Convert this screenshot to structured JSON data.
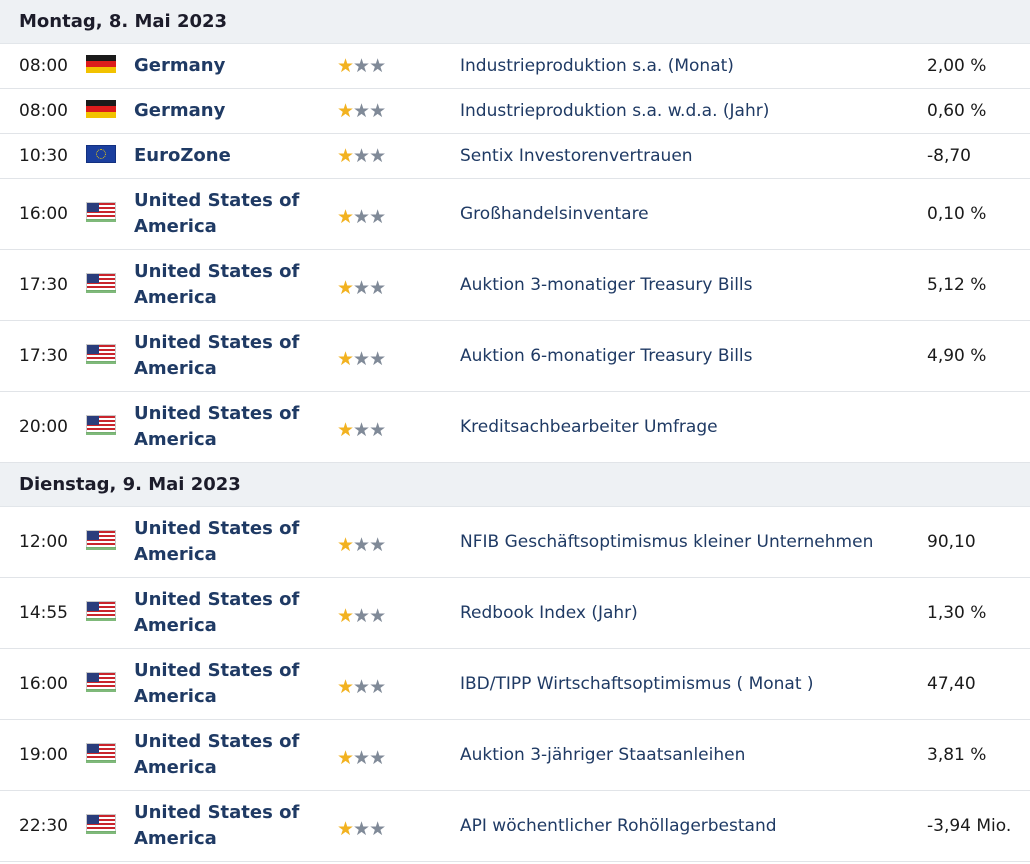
{
  "days": [
    {
      "date": "Montag, 8. Mai 2023",
      "rows": [
        {
          "time": "08:00",
          "flag": "de",
          "country": "Germany",
          "rating": 1,
          "event": "Industrieproduktion s.a. (Monat)",
          "value": "2,00 %",
          "tall": false
        },
        {
          "time": "08:00",
          "flag": "de",
          "country": "Germany",
          "rating": 1,
          "event": "Industrieproduktion s.a. w.d.a. (Jahr)",
          "value": "0,60 %",
          "tall": false
        },
        {
          "time": "10:30",
          "flag": "eu",
          "country": "EuroZone",
          "rating": 1,
          "event": "Sentix Investorenvertrauen",
          "value": "-8,70",
          "tall": false
        },
        {
          "time": "16:00",
          "flag": "us",
          "country": "United States of America",
          "rating": 1,
          "event": "Großhandelsinventare",
          "value": "0,10 %",
          "tall": true
        },
        {
          "time": "17:30",
          "flag": "us",
          "country": "United States of America",
          "rating": 1,
          "event": "Auktion 3-monatiger Treasury Bills",
          "value": "5,12 %",
          "tall": true
        },
        {
          "time": "17:30",
          "flag": "us",
          "country": "United States of America",
          "rating": 1,
          "event": "Auktion 6-monatiger Treasury Bills",
          "value": "4,90 %",
          "tall": true
        },
        {
          "time": "20:00",
          "flag": "us",
          "country": "United States of America",
          "rating": 1,
          "event": "Kreditsachbearbeiter Umfrage",
          "value": "",
          "tall": true
        }
      ]
    },
    {
      "date": "Dienstag, 9. Mai 2023",
      "rows": [
        {
          "time": "12:00",
          "flag": "us",
          "country": "United States of America",
          "rating": 1,
          "event": "NFIB Geschäftsoptimismus kleiner Unternehmen",
          "value": "90,10",
          "tall": true
        },
        {
          "time": "14:55",
          "flag": "us",
          "country": "United States of America",
          "rating": 1,
          "event": "Redbook Index (Jahr)",
          "value": "1,30 %",
          "tall": true
        },
        {
          "time": "16:00",
          "flag": "us",
          "country": "United States of America",
          "rating": 1,
          "event": "IBD/TIPP Wirtschaftsoptimismus ( Monat )",
          "value": "47,40",
          "tall": true
        },
        {
          "time": "19:00",
          "flag": "us",
          "country": "United States of America",
          "rating": 1,
          "event": "Auktion 3-jähriger Staatsanleihen",
          "value": "3,81 %",
          "tall": true
        },
        {
          "time": "22:30",
          "flag": "us",
          "country": "United States of America",
          "rating": 1,
          "event": "API wöchentlicher Rohöllagerbestand",
          "value": "-3,94 Mio.",
          "tall": true
        }
      ]
    }
  ],
  "rating_max": 3,
  "icons": {
    "star": "star-icon",
    "flag_de": "germany-flag-icon",
    "flag_eu": "eu-flag-icon",
    "flag_us": "usa-flag-icon"
  },
  "colors": {
    "country": "#1f3a64",
    "event": "#1f3a64",
    "star_on": "#f2b220",
    "star_off": "#808a98",
    "header_bg": "#eef1f4"
  }
}
